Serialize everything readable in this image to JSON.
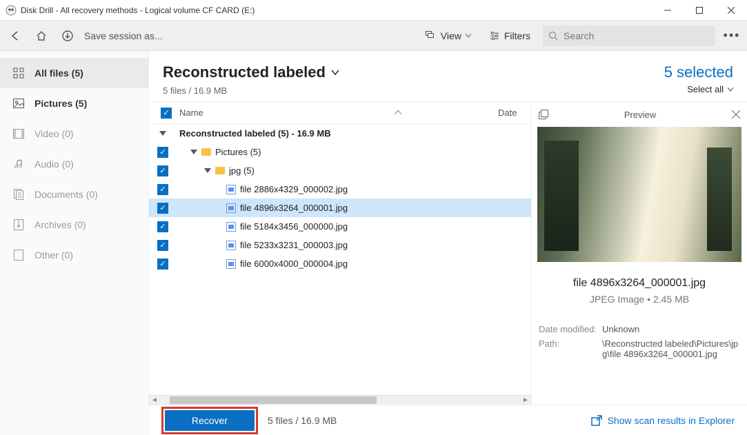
{
  "window": {
    "title": "Disk Drill - All recovery methods - Logical volume CF CARD (E:)"
  },
  "toolbar": {
    "save_label": "Save session as...",
    "view_label": "View",
    "filters_label": "Filters",
    "search_placeholder": "Search"
  },
  "sidebar": {
    "items": [
      {
        "label": "All files (5)",
        "icon": "grid"
      },
      {
        "label": "Pictures (5)",
        "icon": "picture"
      },
      {
        "label": "Video (0)",
        "icon": "video"
      },
      {
        "label": "Audio (0)",
        "icon": "audio"
      },
      {
        "label": "Documents (0)",
        "icon": "document"
      },
      {
        "label": "Archives (0)",
        "icon": "archive"
      },
      {
        "label": "Other (0)",
        "icon": "other"
      }
    ]
  },
  "heading": {
    "title": "Reconstructed labeled",
    "sub": "5 files / 16.9 MB",
    "selected": "5 selected",
    "select_all": "Select all"
  },
  "list": {
    "col_name": "Name",
    "col_date": "Date",
    "group_label": "Reconstructed labeled (5) - 16.9 MB",
    "folder1": "Pictures (5)",
    "folder2": "jpg (5)",
    "files": [
      "file 2886x4329_000002.jpg",
      "file 4896x3264_000001.jpg",
      "file 5184x3456_000000.jpg",
      "file 5233x3231_000003.jpg",
      "file 6000x4000_000004.jpg"
    ]
  },
  "preview": {
    "panel_title": "Preview",
    "filename": "file 4896x3264_000001.jpg",
    "type_size": "JPEG Image • 2.45 MB",
    "date_label": "Date modified:",
    "date_value": "Unknown",
    "path_label": "Path:",
    "path_value": "\\Reconstructed labeled\\Pictures\\jpg\\file 4896x3264_000001.jpg"
  },
  "bottom": {
    "recover": "Recover",
    "summary": "5 files / 16.9 MB",
    "explorer_link": "Show scan results in Explorer"
  }
}
